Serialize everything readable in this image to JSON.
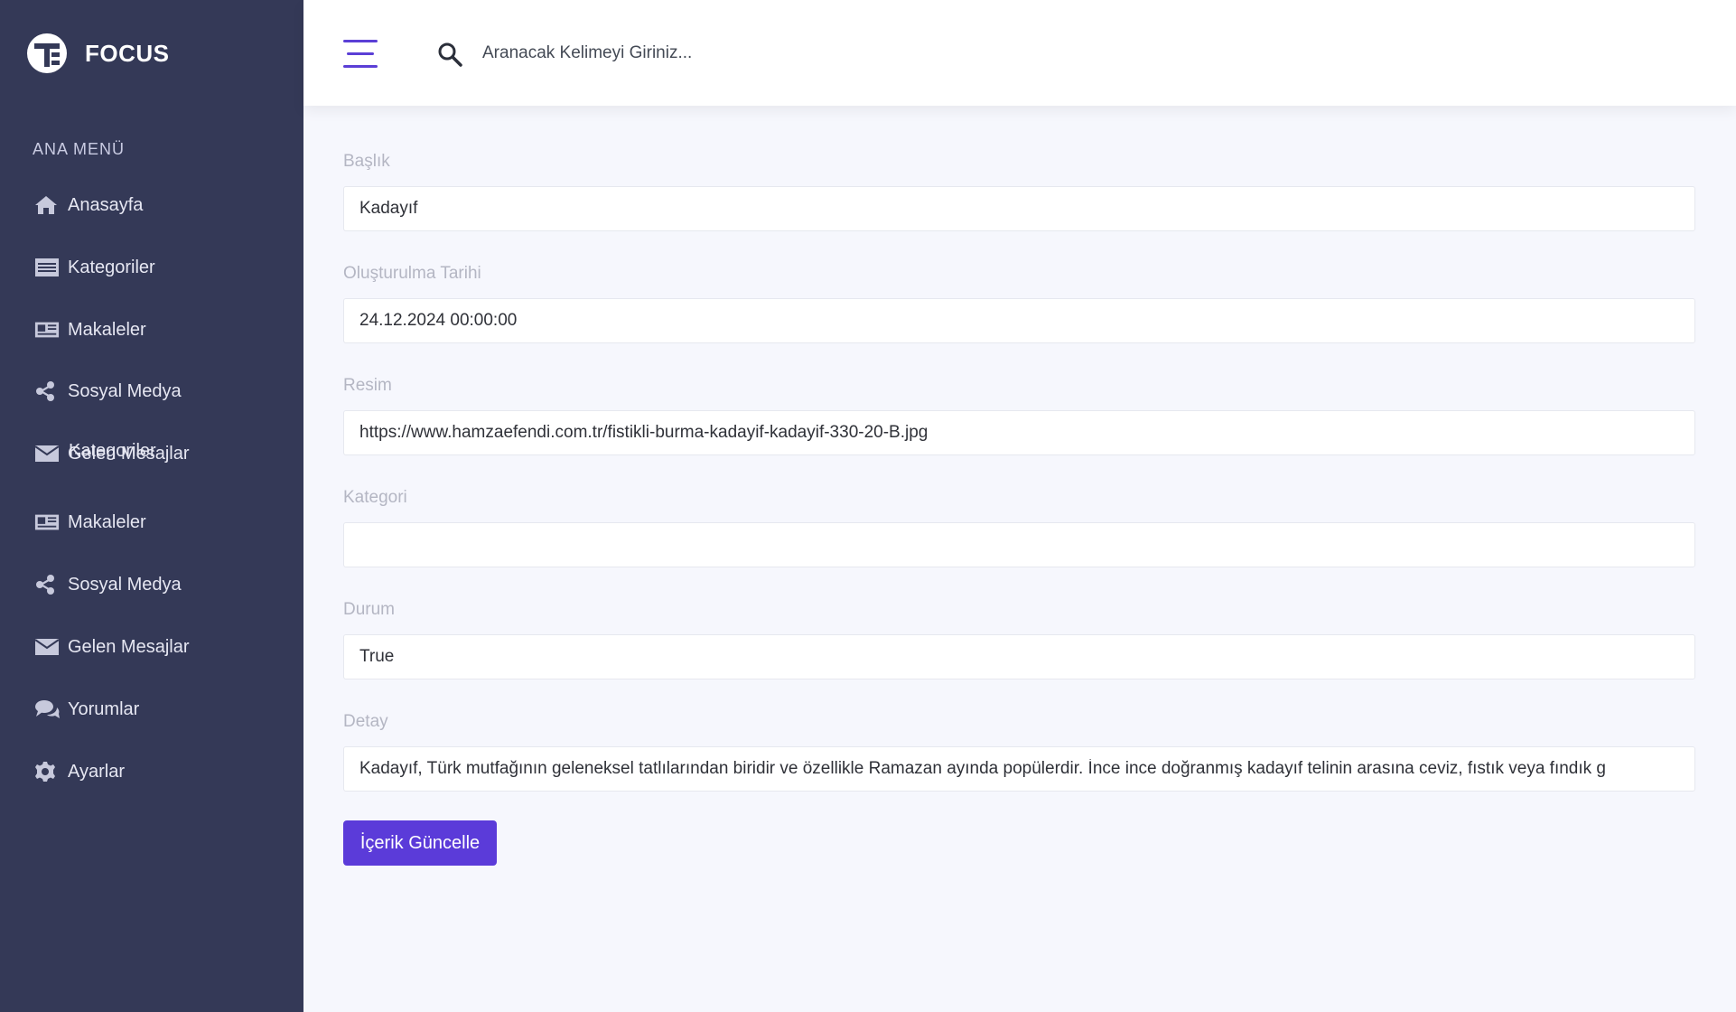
{
  "brand": {
    "name": "FOCUS",
    "logo_icon": "focus-logo-icon"
  },
  "sidebar": {
    "title": "ANA MENÜ",
    "items": [
      {
        "label": "Anasayfa",
        "icon": "home-icon"
      },
      {
        "label": "Kategoriler",
        "icon": "list-icon"
      },
      {
        "label": "Makaleler",
        "icon": "newspaper-icon"
      },
      {
        "label": "Sosyal Medya",
        "icon": "share-icon"
      },
      {
        "label": "Gelen Mesajlar",
        "icon": "envelope-icon"
      },
      {
        "label": "Kategoriler",
        "icon": "list-icon"
      },
      {
        "label": "Makaleler",
        "icon": "newspaper-icon"
      },
      {
        "label": "Sosyal Medya",
        "icon": "share-icon"
      },
      {
        "label": "Gelen Mesajlar",
        "icon": "envelope-icon"
      },
      {
        "label": "Yorumlar",
        "icon": "comments-icon"
      },
      {
        "label": "Ayarlar",
        "icon": "gear-icon"
      }
    ]
  },
  "header": {
    "search_placeholder": "Aranacak Kelimeyi Giriniz..."
  },
  "form": {
    "fields": [
      {
        "label": "Başlık",
        "value": "Kadayıf"
      },
      {
        "label": "Oluşturulma Tarihi",
        "value": "24.12.2024 00:00:00"
      },
      {
        "label": "Resim",
        "value": "https://www.hamzaefendi.com.tr/fistikli-burma-kadayif-kadayif-330-20-B.jpg"
      },
      {
        "label": "Kategori",
        "value": ""
      },
      {
        "label": "Durum",
        "value": "True"
      },
      {
        "label": "Detay",
        "value": "Kadayıf, Türk mutfağının geleneksel tatlılarından biridir ve özellikle Ramazan ayında popülerdir. İnce ince doğranmış kadayıf telinin arasına ceviz, fıstık veya fındık g"
      }
    ],
    "submit_label": "İçerik Güncelle"
  },
  "colors": {
    "sidebar_bg": "#343957",
    "accent": "#5b3bd9",
    "page_bg": "#f6f7fd"
  }
}
